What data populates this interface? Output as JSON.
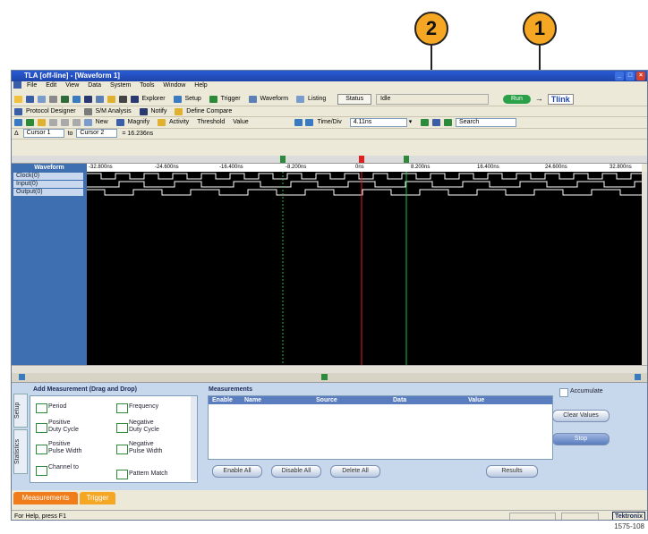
{
  "callouts": {
    "one": "1",
    "two": "2"
  },
  "window": {
    "title": "TLA [off-line] - [Waveform 1]"
  },
  "menu": [
    "File",
    "Edit",
    "View",
    "Data",
    "System",
    "Tools",
    "Window",
    "Help"
  ],
  "toolbar1": {
    "explorer": "Explorer",
    "setup": "Setup",
    "trigger": "Trigger",
    "waveform": "Waveform",
    "listing": "Listing",
    "status": "Status",
    "idle": "Idle",
    "run": "Run",
    "tlink": "Tlink"
  },
  "toolbar2": {
    "protocol": "Protocol Designer",
    "sm": "S/M Analysis",
    "notify": "Notify",
    "compare": "Define Compare"
  },
  "toolbar3": {
    "new": "New",
    "magnify": "Magnify",
    "activity": "Activity",
    "threshold": "Threshold",
    "value": "Value",
    "timediv_label": "Time/Div",
    "timediv_value": "4.11ns",
    "search": "Search"
  },
  "toolbar4": {
    "cursor1": "Cursor 1",
    "to": "to",
    "cursor2": "Cursor 2",
    "delta": "= 16.236ns"
  },
  "timeaxis": [
    "-32.800ns",
    "-24.600ns",
    "-16.400ns",
    "-8.200ns",
    "0ns",
    "8.200ns",
    "16.400ns",
    "24.600ns",
    "32.800ns"
  ],
  "waveform": {
    "header": "Waveform",
    "signals": [
      "Clock(0)",
      "Input(0)",
      "Output(0)"
    ]
  },
  "panel": {
    "side_tabs": [
      "Setup",
      "Statistics"
    ],
    "add_title": "Add Measurement (Drag and Drop)",
    "items": [
      "Period",
      "Frequency",
      "Positive\nDuty Cycle",
      "Negative\nDuty Cycle",
      "Positive\nPulse Width",
      "Negative\nPulse Width",
      "Channel to",
      "Pattern Match"
    ],
    "meas_title": "Measurements",
    "columns": [
      "Enable",
      "Name",
      "Source",
      "Data",
      "Value"
    ],
    "buttons": {
      "enable_all": "Enable All",
      "disable_all": "Disable All",
      "delete_all": "Delete All",
      "results": "Results",
      "accumulate": "Accumulate",
      "clear": "Clear Values",
      "stop": "Stop"
    }
  },
  "bottom_tabs": [
    "Measurements",
    "Trigger"
  ],
  "status": {
    "help": "For Help, press F1",
    "brand": "Tektronix"
  },
  "figure_id": "1575-108",
  "colors": {
    "accent": "#f5a623",
    "trace": "#ffffff",
    "cursor_red": "#e02020",
    "cursor_green": "#20c040"
  }
}
